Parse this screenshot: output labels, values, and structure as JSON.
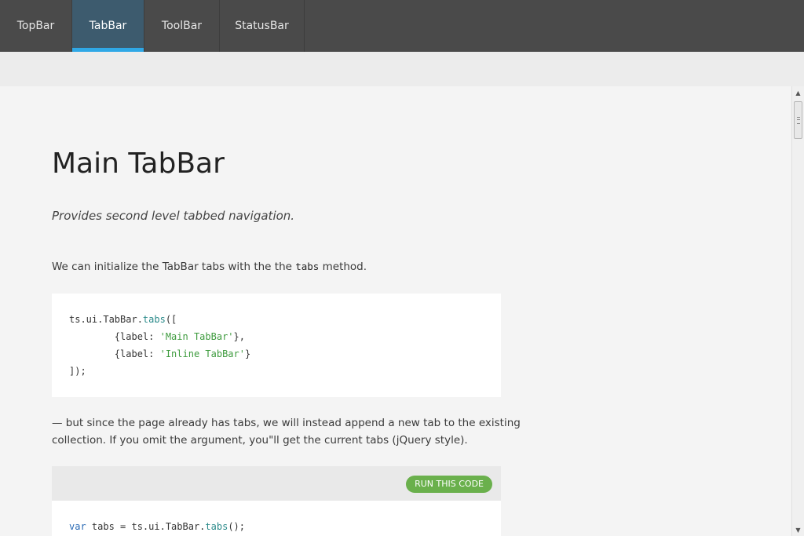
{
  "tabs": [
    {
      "label": "TopBar"
    },
    {
      "label": "TabBar"
    },
    {
      "label": "ToolBar"
    },
    {
      "label": "StatusBar"
    }
  ],
  "active_tab": "TabBar",
  "main": {
    "title": "Main TabBar",
    "subtitle": "Provides second level tabbed navigation.",
    "intro_before": "We can initialize the TabBar tabs with the the ",
    "intro_code": "tabs",
    "intro_after": " method.",
    "code1": {
      "line1_a": "ts.ui.TabBar.",
      "line1_b": "tabs",
      "line1_c": "([",
      "line2_a": "        {label: ",
      "line2_b": "'Main TabBar'",
      "line2_c": "},",
      "line3_a": "        {label: ",
      "line3_b": "'Inline TabBar'",
      "line3_c": "}",
      "line4": "]);"
    },
    "para2_line1": "— but since the page already has tabs, we will instead append a new tab to the existing",
    "para2_line2": "collection. If you omit the argument, you\"ll get the current tabs (jQuery style).",
    "run_button": "RUN THIS CODE",
    "code2": {
      "kw": "var",
      "a": " tabs = ts.ui.TabBar.",
      "fn": "tabs",
      "b": "();"
    }
  },
  "colors": {
    "topbar": "#4a4a4a",
    "active_tab": "#3d5b6e",
    "active_indicator": "#2fa8e6",
    "run_button": "#6ab04c"
  }
}
